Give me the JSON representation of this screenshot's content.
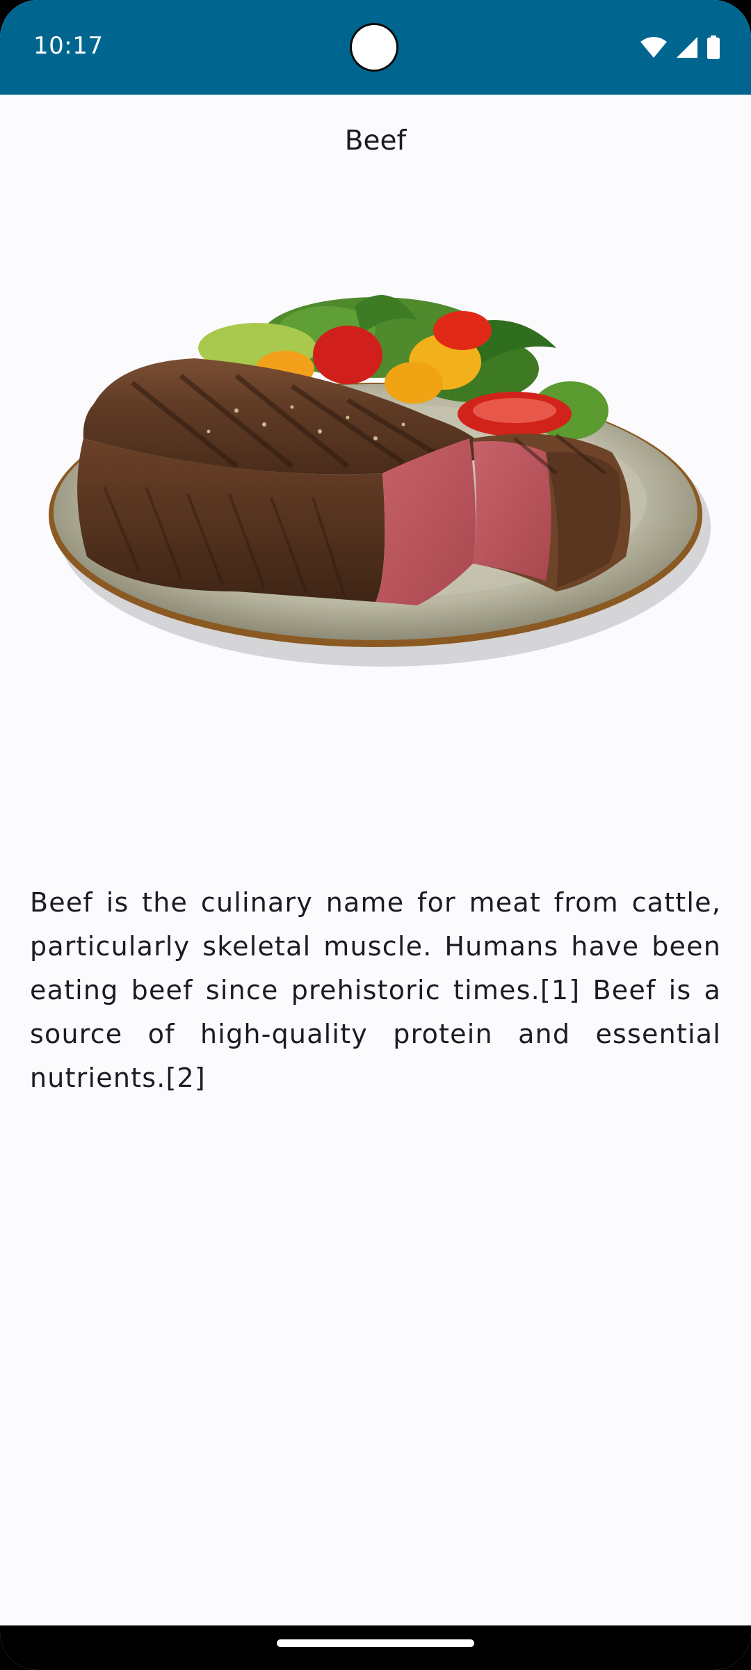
{
  "status_bar": {
    "time": "10:17",
    "background_color": "#006690",
    "icons": [
      "wifi-icon",
      "cellular-signal-icon",
      "battery-icon"
    ]
  },
  "screen": {
    "title": "Beef",
    "image_label": "beef-steak-image",
    "description": "Beef is the culinary name for meat from cattle, particularly skeletal muscle. Humans have been eating beef since prehistoric times.[1] Beef is a source of high-quality protein and essential nutrients.[2]"
  },
  "navigation_bar": {
    "handle": "home-gesture-handle"
  }
}
